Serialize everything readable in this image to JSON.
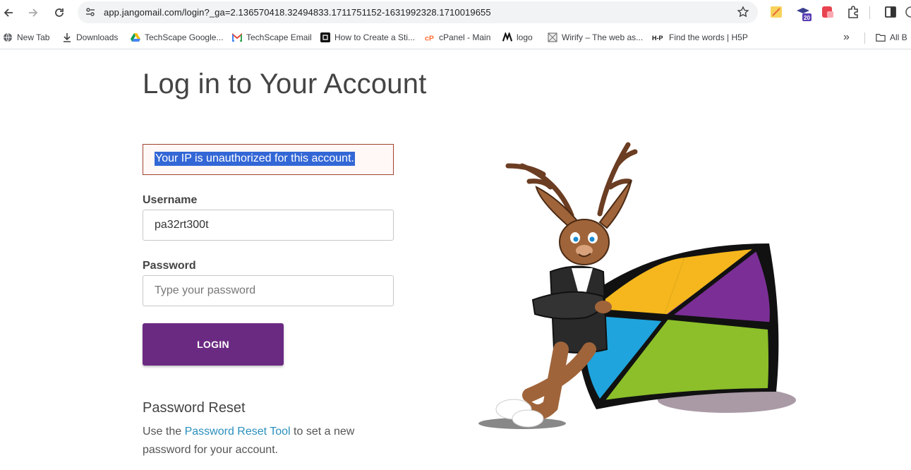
{
  "browser": {
    "url": "app.jangomail.com/login?_ga=2.136570418.32494833.1711751152-1631992328.1710019655",
    "extension_badge": "20",
    "bookmarks": [
      {
        "label": "New Tab",
        "icon": "globe-icon"
      },
      {
        "label": "Downloads",
        "icon": "download-icon"
      },
      {
        "label": "TechScape Google...",
        "icon": "google-drive-icon"
      },
      {
        "label": "TechScape Email",
        "icon": "gmail-icon"
      },
      {
        "label": "How to Create a Sti...",
        "icon": "site-icon"
      },
      {
        "label": "cPanel - Main",
        "icon": "cpanel-icon"
      },
      {
        "label": "logo",
        "icon": "logo-icon"
      },
      {
        "label": "Wirify – The web as...",
        "icon": "wirify-icon"
      },
      {
        "label": "Find the words | H5P",
        "icon": "h5p-icon"
      }
    ],
    "all_bookmarks_label": "All B"
  },
  "page": {
    "title": "Log in to Your Account",
    "error_message": "Your IP is unauthorized for this account.",
    "username_label": "Username",
    "username_value": "pa32rt300t",
    "password_label": "Password",
    "password_placeholder": "Type your password",
    "login_button": "LOGIN",
    "reset_title": "Password Reset",
    "reset_text_before": "Use the ",
    "reset_link": "Password Reset Tool",
    "reset_text_after": " to set a new password for your account."
  },
  "colors": {
    "brand_purple": "#6b2a82",
    "link_blue": "#2a8fbd",
    "error_border": "#a0432f",
    "selection": "#3367d6"
  }
}
